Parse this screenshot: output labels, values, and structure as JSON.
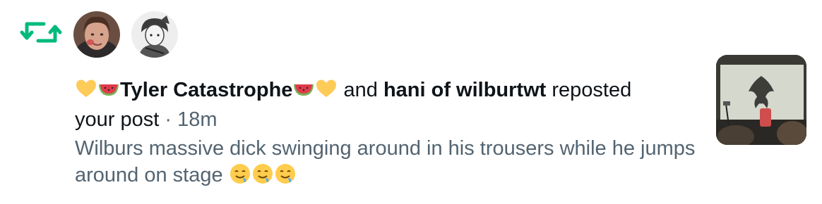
{
  "notification": {
    "icon": "repost-icon",
    "accent_color": "#00ba7c",
    "avatars": [
      {
        "icon": "user-avatar-photo"
      },
      {
        "icon": "user-avatar-illustration"
      }
    ],
    "user1": {
      "name": "Tyler Catastrophe",
      "prefix_emojis": [
        "yellow-heart",
        "watermelon"
      ],
      "suffix_emojis": [
        "watermelon",
        "yellow-heart"
      ]
    },
    "connector": "and",
    "user2": {
      "name": "hani of wilburtwt"
    },
    "action_text": "reposted",
    "object_text": "your post",
    "separator": "·",
    "time": "18m",
    "post_text": "Wilburs massive dick swinging around in his trousers while he jumps around on stage",
    "post_emojis": [
      "drooling-face",
      "drooling-face",
      "drooling-face"
    ],
    "thumbnail": {
      "icon": "concert-photo-thumbnail"
    }
  }
}
